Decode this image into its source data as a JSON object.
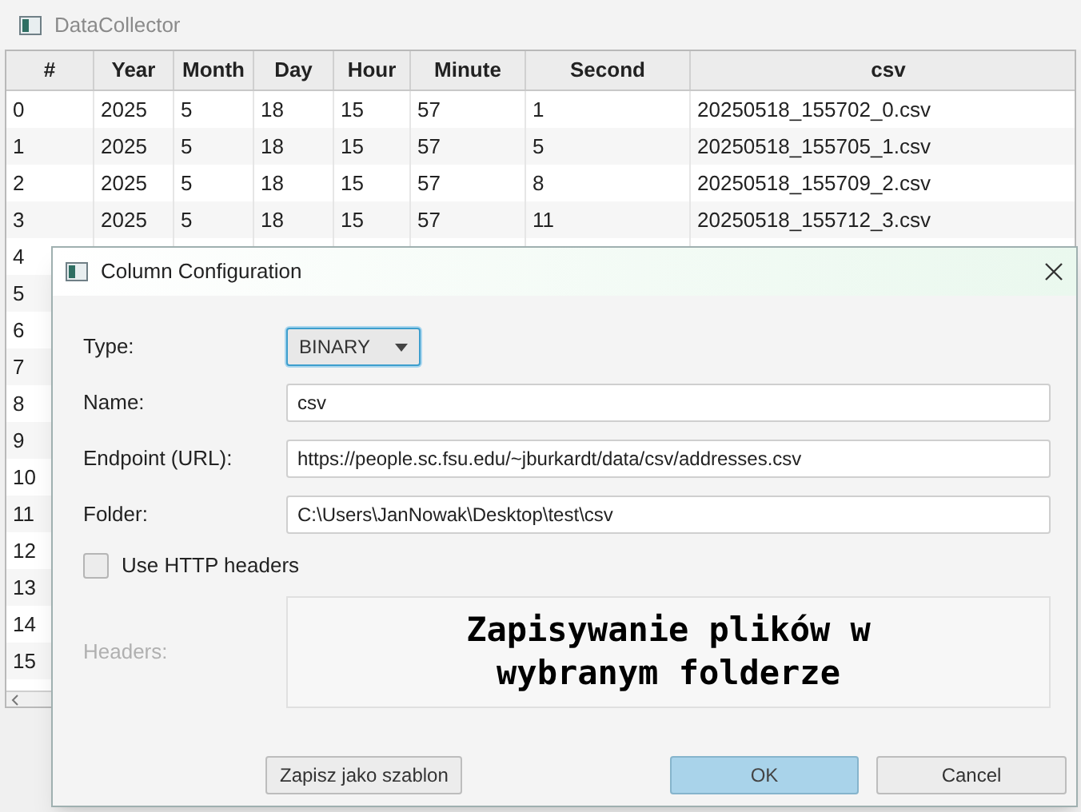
{
  "window": {
    "title": "DataCollector"
  },
  "table": {
    "columns": [
      "#",
      "Year",
      "Month",
      "Day",
      "Hour",
      "Minute",
      "Second",
      "csv"
    ],
    "rows": [
      [
        "0",
        "2025",
        "5",
        "18",
        "15",
        "57",
        "1",
        "20250518_155702_0.csv"
      ],
      [
        "1",
        "2025",
        "5",
        "18",
        "15",
        "57",
        "5",
        "20250518_155705_1.csv"
      ],
      [
        "2",
        "2025",
        "5",
        "18",
        "15",
        "57",
        "8",
        "20250518_155709_2.csv"
      ],
      [
        "3",
        "2025",
        "5",
        "18",
        "15",
        "57",
        "11",
        "20250518_155712_3.csv"
      ],
      [
        "4"
      ],
      [
        "5"
      ],
      [
        "6"
      ],
      [
        "7"
      ],
      [
        "8"
      ],
      [
        "9"
      ],
      [
        "10"
      ],
      [
        "11"
      ],
      [
        "12"
      ],
      [
        "13"
      ],
      [
        "14"
      ],
      [
        "15"
      ]
    ]
  },
  "dialog": {
    "title": "Column Configuration",
    "type": {
      "label": "Type:",
      "value": "BINARY"
    },
    "fields": [
      {
        "label": "Name:",
        "value": "csv"
      },
      {
        "label": "Endpoint (URL):",
        "value": "https://people.sc.fsu.edu/~jburkardt/data/csv/addresses.csv"
      },
      {
        "label": "Folder:",
        "value": "C:\\Users\\JanNowak\\Desktop\\test\\csv"
      }
    ],
    "use_http_headers": {
      "label": "Use HTTP headers",
      "checked": false
    },
    "headers": {
      "label": "Headers:",
      "value": "Zapisywanie plików w\nwybranym folderze"
    },
    "buttons": [
      {
        "label": "Zapisz jako szablon",
        "kind": "secondary"
      },
      {
        "label": "OK",
        "kind": "default"
      },
      {
        "label": "Cancel",
        "kind": "secondary"
      }
    ]
  }
}
